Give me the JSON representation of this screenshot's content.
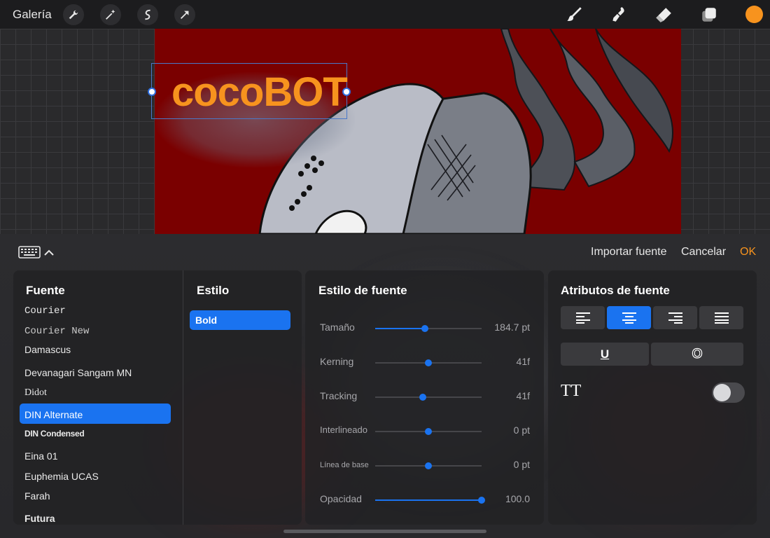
{
  "topbar": {
    "gallery_label": "Galería",
    "left_tools": [
      "wrench-icon",
      "magic-wand-icon",
      "selection-icon",
      "transform-arrow-icon"
    ],
    "right_tools": [
      "brush-icon",
      "smudge-icon",
      "eraser-icon",
      "layers-icon"
    ],
    "current_color": "#f7931e"
  },
  "canvas": {
    "text_layer": "cocoBOT",
    "artboard_color": "#7a0000"
  },
  "panel_header": {
    "import_label": "Importar fuente",
    "cancel_label": "Cancelar",
    "ok_label": "OK"
  },
  "fonts": {
    "title": "Fuente",
    "items": [
      "Courier",
      "Courier New",
      "Damascus",
      "Devanagari Sangam MN",
      "Didot",
      "DIN Alternate",
      "DIN Condensed",
      "Eina 01",
      "Euphemia UCAS",
      "Farah",
      "Futura"
    ],
    "selected": "DIN Alternate"
  },
  "style": {
    "title": "Estilo",
    "items": [
      "Bold"
    ],
    "selected": "Bold"
  },
  "font_style": {
    "title": "Estilo de fuente",
    "sliders": [
      {
        "label": "Tamaño",
        "value": "184.7 pt",
        "level": 0.47
      },
      {
        "label": "Kerning",
        "value": "41f",
        "level": 0.5
      },
      {
        "label": "Tracking",
        "value": "41f",
        "level": 0.45
      },
      {
        "label": "Interlineado",
        "value": "0 pt",
        "level": 0.5
      },
      {
        "label": "Línea de base",
        "value": "0 pt",
        "level": 0.5
      },
      {
        "label": "Opacidad",
        "value": "100.0",
        "level": 1.0
      }
    ]
  },
  "attributes": {
    "title": "Atributos de fuente",
    "alignment_options": [
      "align-left-icon",
      "align-center-icon",
      "align-right-icon",
      "align-justify-icon"
    ],
    "active_alignment": "align-center-icon",
    "underline_label": "U",
    "outline_label": "O",
    "caps_label": "TT",
    "caps_toggle_on": false
  },
  "accent_color": "#1a73f0"
}
